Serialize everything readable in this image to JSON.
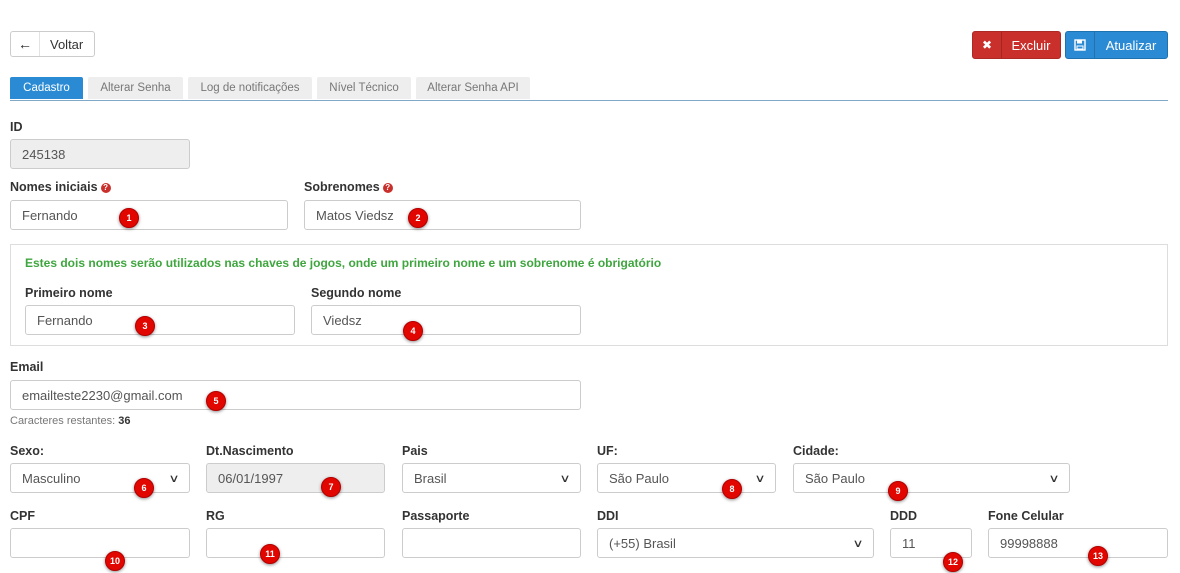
{
  "toolbar": {
    "back_label": "Voltar",
    "delete_label": "Excluir",
    "update_label": "Atualizar"
  },
  "tabs": [
    {
      "label": "Cadastro",
      "active": true
    },
    {
      "label": "Alterar Senha",
      "active": false
    },
    {
      "label": "Log de notificações",
      "active": false
    },
    {
      "label": "Nível Técnico",
      "active": false
    },
    {
      "label": "Alterar Senha API",
      "active": false
    }
  ],
  "form": {
    "id": {
      "label": "ID",
      "value": "245138"
    },
    "nomes_iniciais": {
      "label": "Nomes iniciais",
      "value": "Fernando"
    },
    "sobrenomes": {
      "label": "Sobrenomes",
      "value": "Matos Viedsz"
    },
    "info_message": "Estes dois nomes serão utilizados nas chaves de jogos, onde um primeiro nome e um sobrenome é obrigatório",
    "primeiro_nome": {
      "label": "Primeiro nome",
      "value": "Fernando"
    },
    "segundo_nome": {
      "label": "Segundo nome",
      "value": "Viedsz"
    },
    "email": {
      "label": "Email",
      "value": "emailteste2230@gmail.com"
    },
    "chars_left": {
      "label": "Caracteres restantes:",
      "value": "36"
    },
    "sexo": {
      "label": "Sexo:",
      "value": "Masculino"
    },
    "nascimento": {
      "label": "Dt.Nascimento",
      "value": "06/01/1997"
    },
    "pais": {
      "label": "Pais",
      "value": "Brasil"
    },
    "uf": {
      "label": "UF:",
      "value": "São Paulo"
    },
    "cidade": {
      "label": "Cidade:",
      "value": "São Paulo"
    },
    "cpf": {
      "label": "CPF",
      "value": ""
    },
    "rg": {
      "label": "RG",
      "value": ""
    },
    "passaporte": {
      "label": "Passaporte",
      "value": ""
    },
    "ddi": {
      "label": "DDI",
      "value": "(+55) Brasil"
    },
    "ddd": {
      "label": "DDD",
      "value": "11"
    },
    "fone": {
      "label": "Fone Celular",
      "value": "99998888"
    }
  },
  "markers": [
    "1",
    "2",
    "3",
    "4",
    "5",
    "6",
    "7",
    "8",
    "9",
    "10",
    "11",
    "12",
    "13"
  ],
  "colors": {
    "primary": "#2a8bd4",
    "danger": "#c9302c",
    "success_text": "#3fa63f",
    "marker": "#e10600"
  },
  "icons": {
    "back": "arrow-left-icon",
    "delete": "close-icon",
    "update": "floppy-disk-icon",
    "help": "question-circle-icon",
    "select": "chevron-down-icon"
  }
}
